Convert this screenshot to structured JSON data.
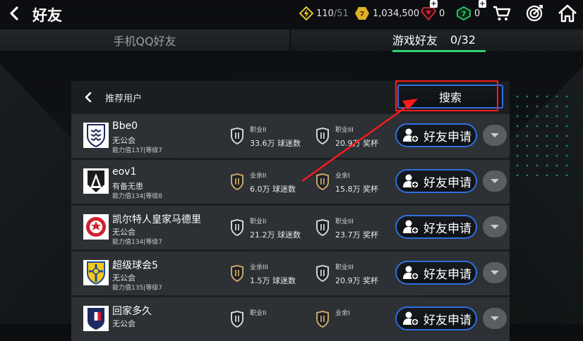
{
  "header": {
    "title": "好友",
    "stamina": "110",
    "stamina_max": "/51",
    "coins": "1,034,500",
    "red_gems": "0",
    "green_gems": "0"
  },
  "tabs": [
    {
      "label": "手机QQ好友"
    },
    {
      "label": "游戏好友",
      "count": "0/32"
    }
  ],
  "panel": {
    "title": "推荐用户",
    "search_label": "搜索"
  },
  "rows": [
    {
      "name": "Bbe0",
      "guild": "无公会",
      "ability": "能力值137|等级7",
      "rank1": "职业II",
      "val1": "33.6万 球迷数",
      "rank2": "职业III",
      "val2": "20.9万 奖杯",
      "button": "好友申请",
      "badge": "england"
    },
    {
      "name": "eov1",
      "guild": "有备无患",
      "ability": "能力值134|等级8",
      "rank1": "业余II",
      "val1": "6.0万 球迷数",
      "rank2": "业余I",
      "val2": "15.8万 奖杯",
      "button": "好友申请",
      "badge": "gladbach"
    },
    {
      "name": "凯尔特人皇家马德里",
      "guild": "无公会",
      "ability": "能力值134|等级7",
      "rank1": "职业II",
      "val1": "21.2万 球迷数",
      "rank2": "职业III",
      "val2": "23.7万 奖杯",
      "button": "好友申请",
      "badge": "toronto"
    },
    {
      "name": "超级球会5",
      "guild": "无公会",
      "ability": "能力值135|等级7",
      "rank1": "业余III",
      "val1": "1.5万 球迷数",
      "rank2": "职业III",
      "val2": "20.9万 奖杯",
      "button": "好友申请",
      "badge": "sweden"
    },
    {
      "name": "回家多久",
      "guild": "无公会",
      "ability": "",
      "rank1": "职业II",
      "val1": "",
      "rank2": "业余I",
      "val2": "",
      "button": "好友申请",
      "badge": "france"
    }
  ],
  "colors": {
    "accent_blue": "#2f6fe0",
    "tab_green": "#2bd46e",
    "annotation_red": "#ff1b1b",
    "pro_silver": "#cfd3d6",
    "amateur_bronze": "#c9a56a"
  }
}
